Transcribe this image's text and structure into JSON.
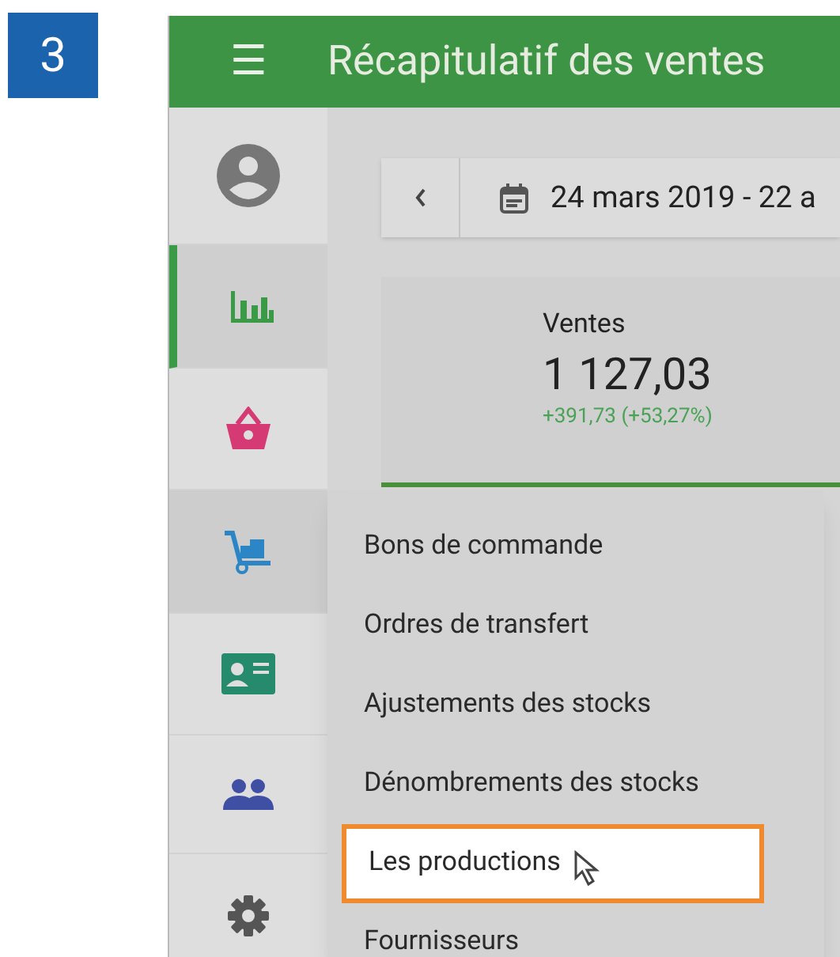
{
  "step": "3",
  "app_bar": {
    "menu": "☰",
    "title": "Récapitulatif des ventes"
  },
  "sidebar": {
    "items": [
      {
        "kind": "avatar",
        "selected": false,
        "expanded": false
      },
      {
        "kind": "reports",
        "selected": true,
        "expanded": false
      },
      {
        "kind": "basket",
        "selected": false,
        "expanded": false
      },
      {
        "kind": "inventory",
        "selected": false,
        "expanded": true
      },
      {
        "kind": "customers-card",
        "selected": false,
        "expanded": false
      },
      {
        "kind": "employees",
        "selected": false,
        "expanded": false
      },
      {
        "kind": "settings",
        "selected": false,
        "expanded": false
      }
    ]
  },
  "date_bar": {
    "range": "24 mars 2019 - 22 a"
  },
  "summary_card": {
    "label": "Ventes",
    "value": "1 127,03",
    "change": "+391,73 (+53,27%)"
  },
  "menu": {
    "items": [
      {
        "label": "Bons de commande",
        "selected": false
      },
      {
        "label": "Ordres de transfert",
        "selected": false
      },
      {
        "label": "Ajustements des stocks",
        "selected": false
      },
      {
        "label": "Dénombrements des stocks",
        "selected": false
      },
      {
        "label": "Les productions",
        "selected": true
      },
      {
        "label": "Fournisseurs",
        "selected": false
      }
    ]
  }
}
